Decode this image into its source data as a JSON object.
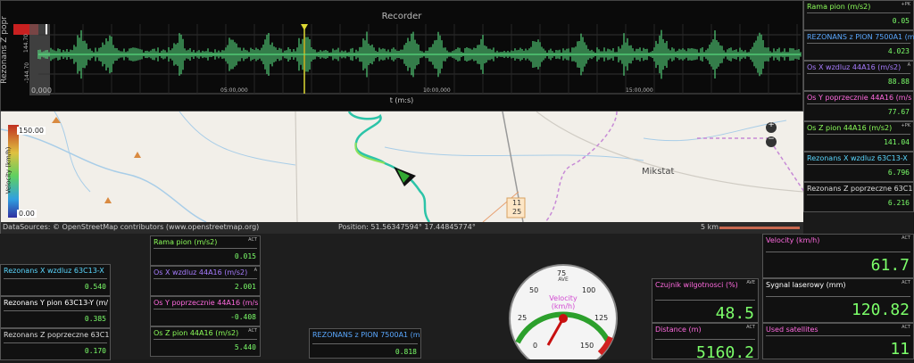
{
  "recorder": {
    "title": "Recorder",
    "y_label": "Rezonans Z popr",
    "y_ticks": [
      "144.70",
      "-144.70"
    ],
    "x_ticks": [
      "0,000",
      "05:00,000",
      "10:00,000",
      "15:00,000"
    ],
    "x_label": "t (m:s)"
  },
  "map": {
    "legend_max": "150.00",
    "legend_min": "0.00",
    "legend_label": "Velocity (km/h)",
    "place": "Mikstat",
    "road_label_1": "11",
    "road_label_2": "25",
    "attribution": "DataSources: © OpenStreetMap contributors (www.openstreetmap.org)",
    "position": "Position: 51.56347594° 17.44845774°",
    "scale": "5 km"
  },
  "right_tiles": [
    {
      "label": "Rama pion (m/s2)",
      "tag": "+PK",
      "value": "0.05",
      "color": "#8cff5a"
    },
    {
      "label": "REZONANS z PION 7500A1 (m",
      "tag": "",
      "value": "4.023",
      "color": "#5aa8ff"
    },
    {
      "label": "Os X wzdluz 44A16 (m/s2)",
      "tag": "A",
      "value": "88.88",
      "color": "#a77cff"
    },
    {
      "label": "Os Y poprzecznie 44A16 (m/s",
      "tag": "",
      "value": "77.67",
      "color": "#ff6adf"
    },
    {
      "label": "Os Z pion 44A16 (m/s2)",
      "tag": "+PK",
      "value": "141.04",
      "color": "#8cff5a"
    },
    {
      "label": "Rezonans X wzdluz 63C13-X",
      "tag": "",
      "value": "6.796",
      "color": "#5ad8ff"
    },
    {
      "label": "Rezonans Z poprzeczne 63C1",
      "tag": "",
      "value": "6.216",
      "color": "#dddddd"
    }
  ],
  "left_tiles": [
    {
      "label": "Rezonans X wzdluz 63C13-X",
      "value": "0.540",
      "color": "#5ad8ff"
    },
    {
      "label": "Rezonans Y pion 63C13-Y (m/",
      "value": "0.385",
      "color": "#ffffff"
    },
    {
      "label": "Rezonans Z poprzeczne 63C1",
      "value": "0.170",
      "color": "#dddddd"
    }
  ],
  "mid_tiles": [
    {
      "label": "Rama pion (m/s2)",
      "tag": "ACT",
      "value": "0.015",
      "color": "#8cff5a"
    },
    {
      "label": "Os X wzdluz 44A16 (m/s2)",
      "tag": "A",
      "value": "2.001",
      "color": "#a77cff"
    },
    {
      "label": "Os Y poprzecznie 44A16 (m/s",
      "tag": "",
      "value": "-0.408",
      "color": "#ff6adf"
    },
    {
      "label": "Os Z pion 44A16 (m/s2)",
      "tag": "ACT",
      "value": "5.440",
      "color": "#8cff5a"
    }
  ],
  "rez_tile": {
    "label": "REZONANS z PION 7500A1 (m",
    "value": "0.818",
    "color": "#5aa8ff"
  },
  "gauge": {
    "label": "Velocity",
    "unit": "(km/h)",
    "tag": "AVE",
    "ticks": [
      "0",
      "25",
      "50",
      "75",
      "100",
      "125",
      "150"
    ]
  },
  "big_tiles": [
    {
      "label": "Czujnik wilgotnosci (%)",
      "tag": "AVE",
      "value": "48.5",
      "color": "#ff6adf"
    },
    {
      "label": "Distance (m)",
      "tag": "ACT",
      "value": "5160.2",
      "color": "#ff6adf"
    },
    {
      "label": "Velocity (km/h)",
      "tag": "ACT",
      "value": "61.7",
      "color": "#ff6adf"
    },
    {
      "label": "Sygnal laserowy (mm)",
      "tag": "ACT",
      "value": "120.82",
      "color": "#ffffff"
    },
    {
      "label": "Used satellites",
      "tag": "ACT",
      "value": "11",
      "color": "#ff6adf"
    }
  ]
}
